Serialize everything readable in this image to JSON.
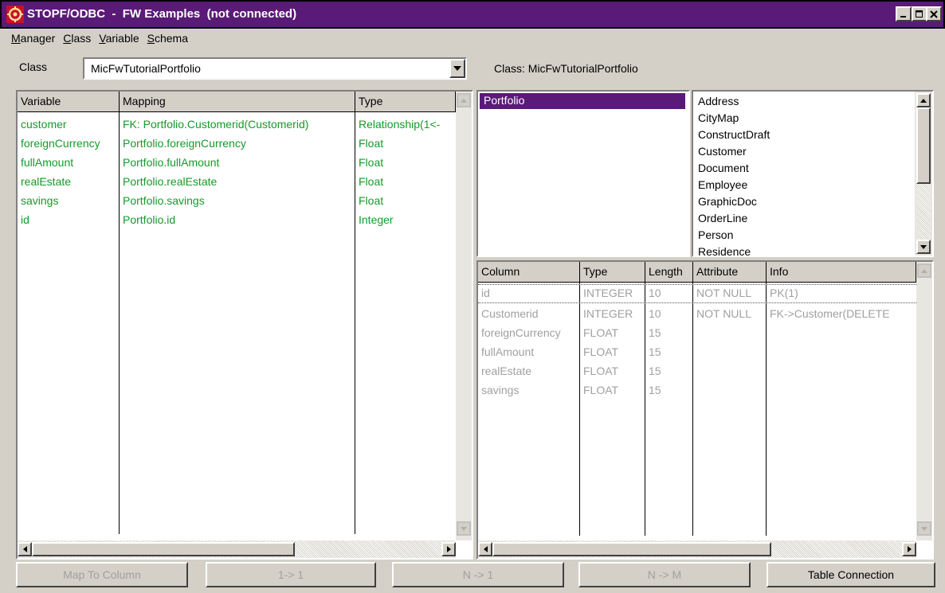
{
  "window": {
    "title": "STOPF/ODBC  -  FW Examples  (not connected)"
  },
  "menu": [
    {
      "label": "Manager",
      "accel": "M",
      "rest": "anager"
    },
    {
      "label": "Class",
      "accel": "C",
      "rest": "lass"
    },
    {
      "label": "Variable",
      "accel": "V",
      "rest": "ariable"
    },
    {
      "label": "Schema",
      "accel": "S",
      "rest": "chema"
    }
  ],
  "class_selector": {
    "label": "Class",
    "value": "MicFwTutorialPortfolio",
    "caption": "Class: MicFwTutorialPortfolio"
  },
  "variables_grid": {
    "headers": [
      "Variable",
      "Mapping",
      "Type"
    ],
    "rows": [
      [
        "customer",
        "FK: Portfolio.Customerid(Customerid)",
        "Relationship(1<-"
      ],
      [
        "foreignCurrency",
        "Portfolio.foreignCurrency",
        "Float"
      ],
      [
        "fullAmount",
        "Portfolio.fullAmount",
        "Float"
      ],
      [
        "realEstate",
        "Portfolio.realEstate",
        "Float"
      ],
      [
        "savings",
        "Portfolio.savings",
        "Float"
      ],
      [
        "id",
        "Portfolio.id",
        "Integer"
      ]
    ]
  },
  "tables_list": {
    "selected": "Portfolio"
  },
  "classes_list": {
    "items": [
      "Address",
      "CityMap",
      "ConstructDraft",
      "Customer",
      "Document",
      "Employee",
      "GraphicDoc",
      "OrderLine",
      "Person",
      "Residence"
    ]
  },
  "columns_grid": {
    "headers": [
      "Column",
      "Type",
      "Length",
      "Attribute",
      "Info"
    ],
    "rows": [
      [
        "id",
        "INTEGER",
        "10",
        "NOT NULL",
        "PK(1)"
      ],
      [
        "Customerid",
        "INTEGER",
        "10",
        "NOT NULL",
        "FK->Customer(DELETE"
      ],
      [
        "foreignCurrency",
        "FLOAT",
        "15",
        "",
        ""
      ],
      [
        "fullAmount",
        "FLOAT",
        "15",
        "",
        ""
      ],
      [
        "realEstate",
        "FLOAT",
        "15",
        "",
        ""
      ],
      [
        "savings",
        "FLOAT",
        "15",
        "",
        ""
      ]
    ]
  },
  "buttons": {
    "map_to_column": "Map To Column",
    "one_to_one": "1-> 1",
    "n_to_one": "N -> 1",
    "n_to_m": "N -> M",
    "table_connection": "Table Connection"
  },
  "colors": {
    "title_bar": "#5a1a77",
    "mapped_text": "#159a2a",
    "disabled_text": "#a0a0a0",
    "face": "#d4d0c8"
  }
}
